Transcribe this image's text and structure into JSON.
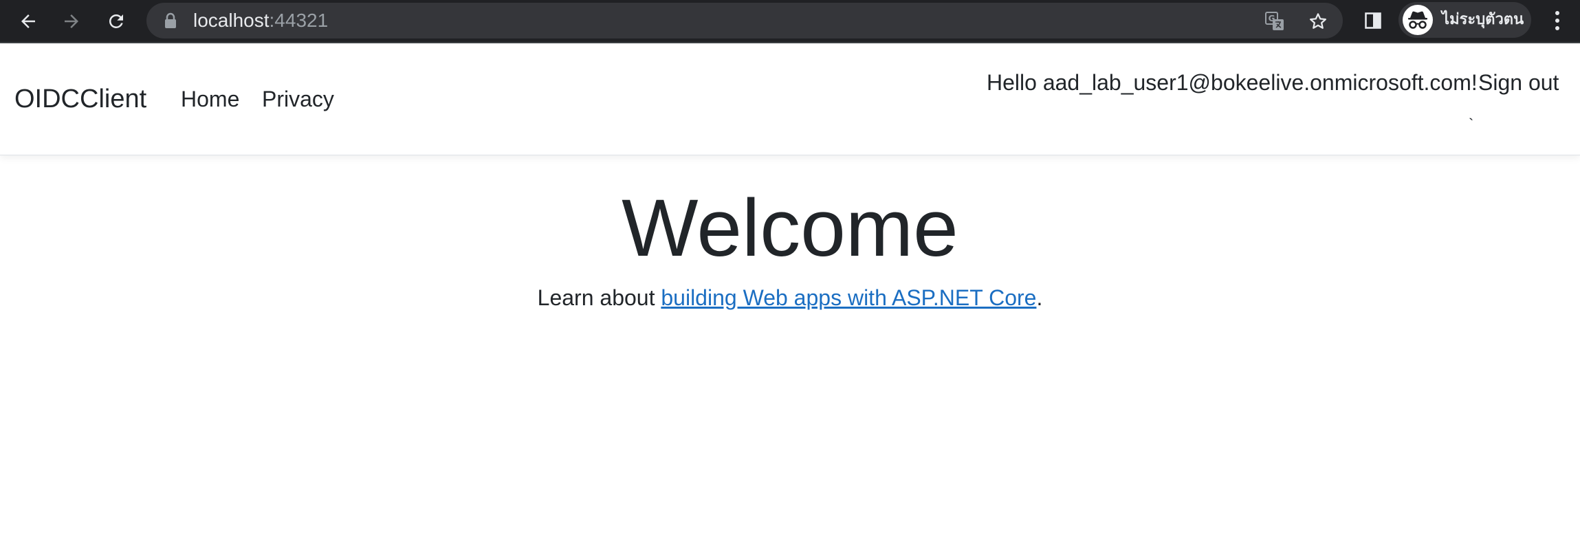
{
  "browser": {
    "url_host": "localhost",
    "url_port": ":44321",
    "profile_label": "ไม่ระบุตัวตน",
    "icons": {
      "back": "arrow-left-icon",
      "forward": "arrow-right-icon",
      "reload": "reload-icon",
      "lock": "lock-icon",
      "translate": "translate-icon",
      "bookmark": "star-icon",
      "side_panel": "side-panel-icon",
      "profile": "incognito-icon",
      "menu": "kebab-menu-icon"
    },
    "colors": {
      "toolbar_bg": "#202124",
      "omnibox_bg": "#35363a"
    }
  },
  "navbar": {
    "brand": "OIDCClient",
    "links": [
      {
        "label": "Home"
      },
      {
        "label": "Privacy"
      }
    ],
    "greeting": "Hello aad_lab_user1@bokeelive.onmicrosoft.com!",
    "sign_out": "Sign out",
    "stray_char": "`"
  },
  "main": {
    "title": "Welcome",
    "learn_prefix": "Learn about ",
    "learn_link": "building Web apps with ASP.NET Core",
    "learn_suffix": ".",
    "colors": {
      "link": "#1b6ec2",
      "text": "#212529"
    }
  }
}
